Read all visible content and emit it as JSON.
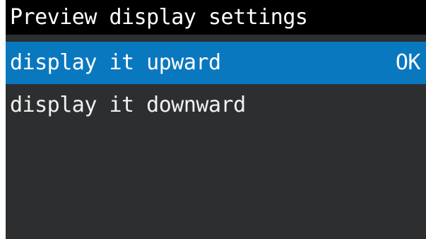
{
  "screen": {
    "title": "Preview display settings"
  },
  "menu": {
    "items": [
      {
        "label": "display it upward",
        "status": "OK",
        "selected": true
      },
      {
        "label": "display it downward",
        "status": "",
        "selected": false
      }
    ]
  },
  "colors": {
    "title_bar_bg": "#000000",
    "screen_bg": "#2d2e30",
    "selected_bg": "#0a78bf",
    "text": "#ffffff"
  }
}
